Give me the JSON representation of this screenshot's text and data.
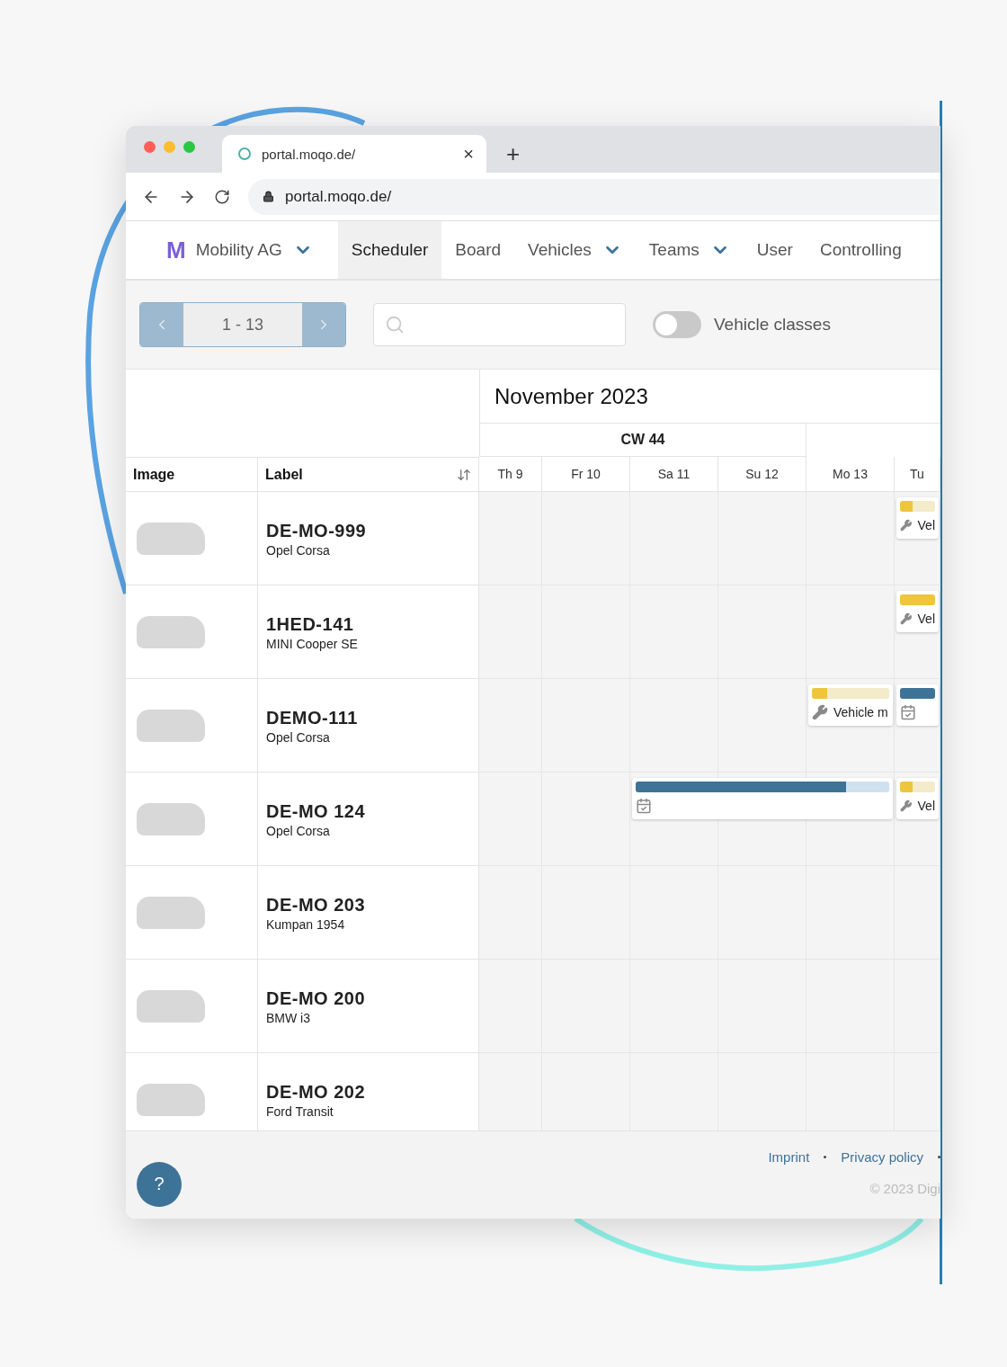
{
  "browser": {
    "tab_title": "portal.moqo.de/",
    "url": "portal.moqo.de/",
    "close": "×",
    "new_tab": "+"
  },
  "nav": {
    "logo": "M",
    "org": "Mobility AG",
    "items": [
      {
        "label": "Scheduler",
        "selected": true,
        "dropdown": false
      },
      {
        "label": "Board",
        "selected": false,
        "dropdown": false
      },
      {
        "label": "Vehicles",
        "selected": false,
        "dropdown": true
      },
      {
        "label": "Teams",
        "selected": false,
        "dropdown": true
      },
      {
        "label": "User",
        "selected": false,
        "dropdown": false
      },
      {
        "label": "Controlling",
        "selected": false,
        "dropdown": false
      }
    ]
  },
  "toolbar": {
    "pager": "1 - 13",
    "vehicle_classes": {
      "label": "Vehicle classes",
      "on": false
    }
  },
  "scheduler": {
    "month": "November 2023",
    "week": "CW 44",
    "columns": [
      "Image",
      "Label"
    ],
    "days": [
      "Th 9",
      "Fr 10",
      "Sa 11",
      "Su 12",
      "Mo 13",
      "Tu"
    ],
    "rows": [
      {
        "plate": "DE-MO-999",
        "model": "Opel Corsa",
        "events": [
          {
            "kind": "maintenance",
            "label": "Vel",
            "level": 0.35
          }
        ]
      },
      {
        "plate": "1HED-141",
        "model": "MINI Cooper SE",
        "events": [
          {
            "kind": "maintenance",
            "label": "Vel",
            "level": 1
          }
        ]
      },
      {
        "plate": "DEMO-111",
        "model": "Opel Corsa",
        "events": [
          {
            "kind": "maintenance",
            "label": "Vehicle m",
            "level": 0.2
          },
          {
            "kind": "booking",
            "level": 1
          }
        ]
      },
      {
        "plate": "DE-MO 124",
        "model": "Opel Corsa",
        "events": [
          {
            "kind": "booking",
            "level": 0.83
          },
          {
            "kind": "maintenance",
            "label": "Vel",
            "level": 0.35
          }
        ]
      },
      {
        "plate": "DE-MO 203",
        "model": "Kumpan 1954",
        "events": []
      },
      {
        "plate": "DE-MO 200",
        "model": "BMW i3",
        "events": []
      },
      {
        "plate": "DE-MO 202",
        "model": "Ford Transit",
        "events": []
      }
    ]
  },
  "footer": {
    "links": [
      "Imprint",
      "Privacy policy"
    ],
    "copyright": "© 2023 Digi",
    "help": "?"
  }
}
